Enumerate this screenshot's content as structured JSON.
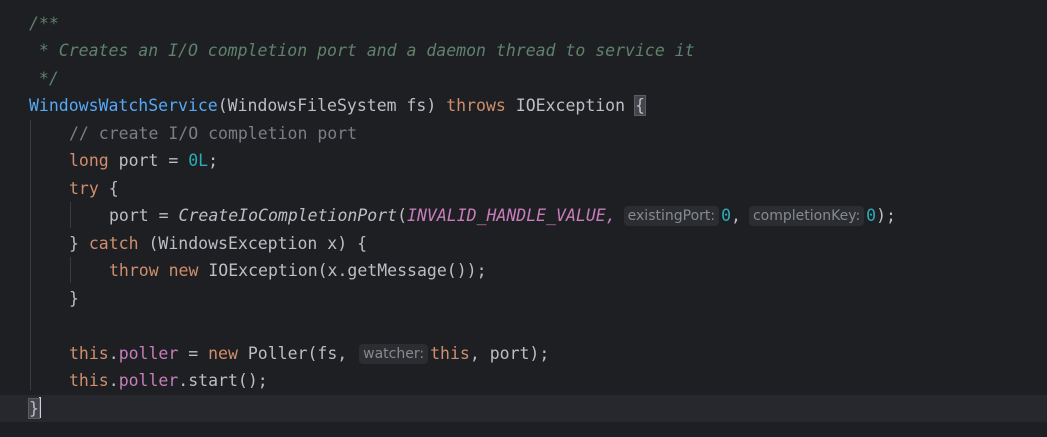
{
  "editor": {
    "lines": {
      "doc_open": "/**",
      "doc_body": " * Creates an I/O completion port and a daemon thread to service it",
      "doc_close": " */",
      "ctor_name": "WindowsWatchService",
      "ctor_params": "(WindowsFileSystem fs) ",
      "ctor_throws": "throws",
      "ctor_exception": " IOException ",
      "open_brace": "{",
      "comment_create": "// create I/O completion port",
      "long_kw": "long",
      "port_decl": " port = ",
      "port_init": "0L",
      "semicolon": ";",
      "try_kw": "try",
      "try_brace": " {",
      "port_assign": "port = ",
      "create_fn": "CreateIoCompletionPort",
      "paren_open": "(",
      "invalid_handle": "INVALID_HANDLE_VALUE",
      "comma": ",",
      "hint_existing_port": "existingPort:",
      "zero_a": "0",
      "hint_completion_key": "completionKey:",
      "zero_b": "0",
      "call_end": ");",
      "catch_close": "} ",
      "catch_kw": "catch",
      "catch_rest": " (WindowsException x) {",
      "throw_kw": "throw",
      "new_kw": "new",
      "throw_rest": " IOException(x.getMessage());",
      "close_brace_inner": "}",
      "this_kw": "this",
      "dot": ".",
      "poller_field": "poller",
      "assign_eq": " = ",
      "poller_rest": " Poller(fs, ",
      "hint_watcher": "watcher:",
      "this_arg": "this",
      "poller_end": ", port);",
      "start_call": ".start();",
      "close_brace_outer": "}"
    }
  }
}
